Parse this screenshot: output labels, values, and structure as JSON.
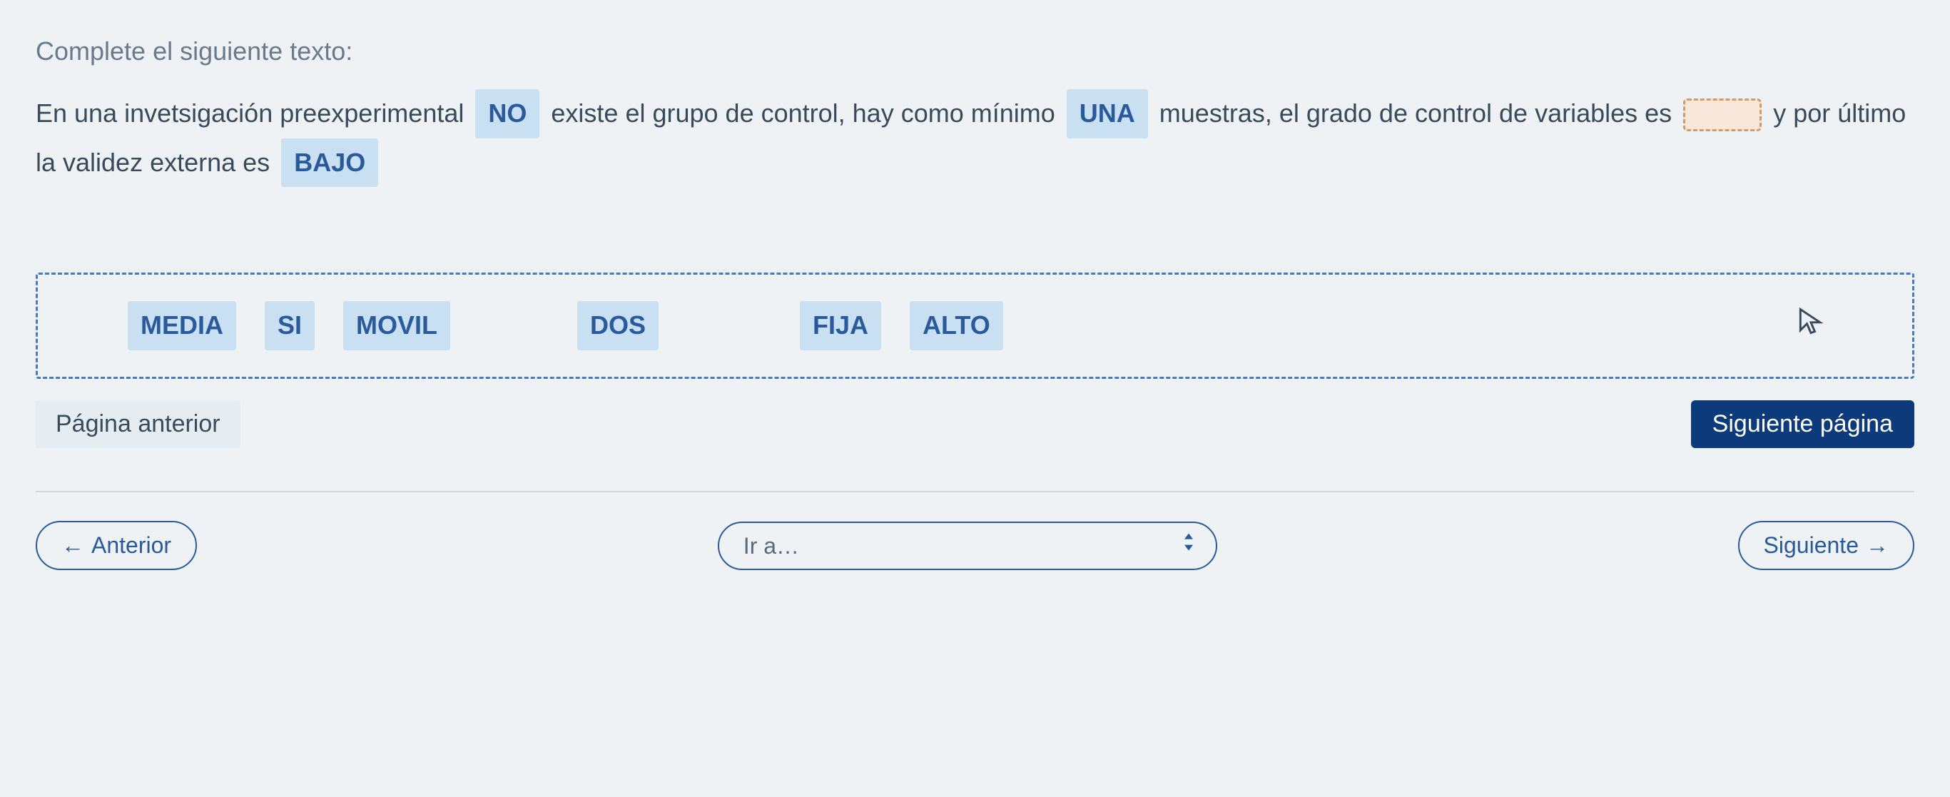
{
  "instruction": "Complete el siguiente texto:",
  "paragraph": {
    "t1": "En una invetsigación  preexperimental",
    "chip1": "NO",
    "t2": "existe el grupo de control, hay como mínimo",
    "chip2": "UNA",
    "t3": "muestras, el grado de control de variables es",
    "t4": "y por último la validez externa es",
    "chip3": "BAJO"
  },
  "options": {
    "o1": "MEDIA",
    "o2": "SI",
    "o3": "MOVIL",
    "o4": "DOS",
    "o5": "FIJA",
    "o6": "ALTO"
  },
  "pager": {
    "prev": "Página anterior",
    "next": "Siguiente página"
  },
  "bottom": {
    "prev": "Anterior",
    "goto_placeholder": "Ir a…",
    "next": "Siguiente"
  }
}
